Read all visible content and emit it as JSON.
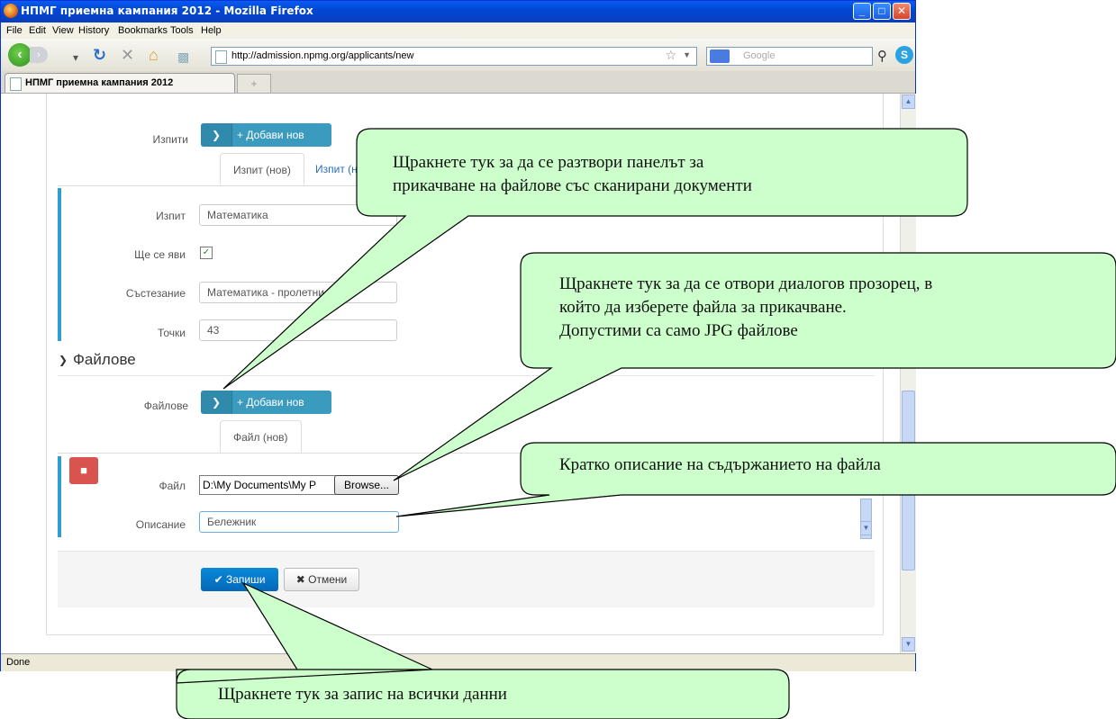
{
  "window": {
    "title": "НПМГ приемна кампания 2012 - Mozilla Firefox",
    "min_label": "_",
    "max_label": "□",
    "close_label": "✕"
  },
  "menu": [
    "File",
    "Edit",
    "View",
    "History",
    "Bookmarks",
    "Tools",
    "Help"
  ],
  "nav": {
    "url": "http://admission.npmg.org/applicants/new",
    "search_placeholder": "Google"
  },
  "tab": {
    "title": "НПМГ приемна кампания 2012",
    "new_tab_label": "+"
  },
  "status": "Done",
  "form": {
    "exams_label": "Изпити",
    "add_new_label": "+ Добави нов",
    "exam_tab_active": "Изпит (нов)",
    "exam_tab_second": "Изпит (нов)",
    "exam_label": "Изпит",
    "exam_value": "Математика",
    "will_attend_label": "Ще се яви",
    "will_attend_checked": true,
    "contest_label": "Състезание",
    "contest_value": "Математика - пролетни (Пр",
    "points_label": "Точки",
    "points_value": "43",
    "files_section_title": "Файлове",
    "files_label": "Файлове",
    "file_tab": "Файл (нов)",
    "file_label": "Файл",
    "file_value": "D:\\My Documents\\My P",
    "browse_label": "Browse...",
    "description_label": "Описание",
    "description_value": "Бележник",
    "save_label": "Запиши",
    "cancel_label": "Отмени"
  },
  "callouts": {
    "open_files_panel": [
      "Щракнете тук за да се разтвори панелът за",
      "прикачване на файлове със сканирани документи"
    ],
    "open_dialog": [
      "Щракнете тук за да се отвори диалогов прозорец, в",
      "който да изберете файла за прикачване.",
      "Допустими са само JPG файлове"
    ],
    "description": [
      "Кратко описание на съдържанието на файла"
    ],
    "save_all": [
      "Щракнете тук за запис на всички данни"
    ]
  },
  "colors": {
    "titlebar": "#0a5bf0",
    "callout_fill": "#ccffcc",
    "primary_button": "#0a88d8",
    "info_button": "#3a9bbf",
    "danger_button": "#d9534f",
    "accent_bar": "#2f9fd0"
  }
}
